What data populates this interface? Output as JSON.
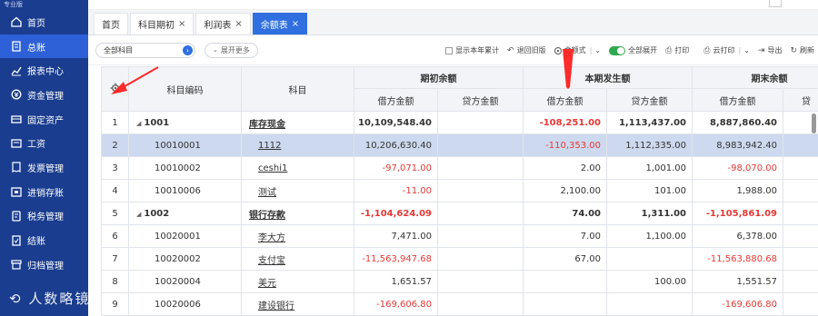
{
  "sidebar": {
    "version_text": "专业版",
    "items": [
      {
        "label": "首页",
        "icon": "home-icon"
      },
      {
        "label": "总账",
        "icon": "ledger-icon"
      },
      {
        "label": "报表中心",
        "icon": "chart-icon"
      },
      {
        "label": "资金管理",
        "icon": "money-icon"
      },
      {
        "label": "固定资产",
        "icon": "asset-icon"
      },
      {
        "label": "工资",
        "icon": "salary-icon"
      },
      {
        "label": "发票管理",
        "icon": "invoice-icon"
      },
      {
        "label": "进销存账",
        "icon": "inventory-icon"
      },
      {
        "label": "税务管理",
        "icon": "tax-icon"
      },
      {
        "label": "结账",
        "icon": "close-account-icon"
      },
      {
        "label": "归档管理",
        "icon": "archive-icon"
      }
    ],
    "active_index": 1
  },
  "tabs": [
    {
      "label": "首页",
      "closable": false
    },
    {
      "label": "科目期初",
      "closable": true
    },
    {
      "label": "利润表",
      "closable": true
    },
    {
      "label": "余额表",
      "closable": true,
      "active": true
    }
  ],
  "toolbar": {
    "subject_select": "全部科目",
    "expand_more": "展开更多",
    "show_year_total": "显示本年累计",
    "back_old_version": "退回旧版",
    "amount_style": "金额式",
    "expand_all": "全部展开",
    "print": "打印",
    "cloud_print": "云打印",
    "export": "导出",
    "refresh": "刷新"
  },
  "table": {
    "headers": {
      "code": "科目编码",
      "subject": "科目",
      "opening": "期初余额",
      "period": "本期发生额",
      "closing": "期末余额",
      "debit": "借方金额",
      "credit": "贷方金额",
      "credit_cut": "贷"
    },
    "rows": [
      {
        "no": "1",
        "code": "1001",
        "level": 1,
        "subject": "库存现金",
        "ob_debit": "10,109,548.40",
        "ob_credit": "",
        "pd_debit": "-108,251.00",
        "pd_credit": "1,113,437.00",
        "cb_debit": "8,887,860.40",
        "cb_credit": ""
      },
      {
        "no": "2",
        "code": "10010001",
        "level": 2,
        "subject": "1112",
        "ob_debit": "10,206,630.40",
        "ob_credit": "",
        "pd_debit": "-110,353.00",
        "pd_credit": "1,112,335.00",
        "cb_debit": "8,983,942.40",
        "cb_credit": "",
        "selected": true
      },
      {
        "no": "3",
        "code": "10010002",
        "level": 2,
        "subject": "ceshi1",
        "ob_debit": "-97,071.00",
        "ob_credit": "",
        "pd_debit": "2.00",
        "pd_credit": "1,001.00",
        "cb_debit": "-98,070.00",
        "cb_credit": ""
      },
      {
        "no": "4",
        "code": "10010006",
        "level": 2,
        "subject": "测试",
        "ob_debit": "-11.00",
        "ob_credit": "",
        "pd_debit": "2,100.00",
        "pd_credit": "101.00",
        "cb_debit": "1,988.00",
        "cb_credit": ""
      },
      {
        "no": "5",
        "code": "1002",
        "level": 1,
        "subject": "银行存款",
        "ob_debit": "-1,104,624.09",
        "ob_credit": "",
        "pd_debit": "74.00",
        "pd_credit": "1,311.00",
        "cb_debit": "-1,105,861.09",
        "cb_credit": ""
      },
      {
        "no": "6",
        "code": "10020001",
        "level": 2,
        "subject": "李大方",
        "ob_debit": "7,471.00",
        "ob_credit": "",
        "pd_debit": "7.00",
        "pd_credit": "1,100.00",
        "cb_debit": "6,378.00",
        "cb_credit": ""
      },
      {
        "no": "7",
        "code": "10020002",
        "level": 2,
        "subject": "支付宝",
        "ob_debit": "-11,563,947.68",
        "ob_credit": "",
        "pd_debit": "67.00",
        "pd_credit": "",
        "cb_debit": "-11,563,880.68",
        "cb_credit": ""
      },
      {
        "no": "8",
        "code": "10020004",
        "level": 2,
        "subject": "美元",
        "ob_debit": "1,651.57",
        "ob_credit": "",
        "pd_debit": "",
        "pd_credit": "100.00",
        "cb_debit": "1,551.57",
        "cb_credit": ""
      },
      {
        "no": "9",
        "code": "10020006",
        "level": 2,
        "subject": "建设银行",
        "ob_debit": "-169,606.80",
        "ob_credit": "",
        "pd_debit": "",
        "pd_credit": "",
        "cb_debit": "-169,606.80",
        "cb_credit": ""
      }
    ]
  },
  "watermark": "人数略镜",
  "colors": {
    "sidebar_bg": "#1a3d8f",
    "sidebar_active": "#2e60d8",
    "tab_active": "#2f6fe0",
    "negative": "#e53935",
    "selected_row": "#cdd9ee",
    "annotation_arrow": "#ff2a2a"
  }
}
